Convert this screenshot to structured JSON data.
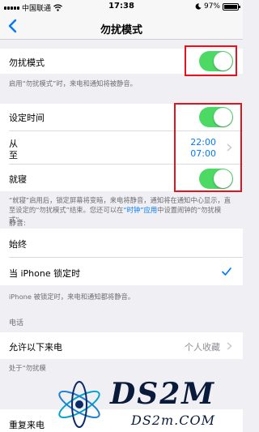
{
  "status": {
    "carrier": "中国联通",
    "time": "17:38",
    "battery": "97%",
    "battery_level": 0.97
  },
  "nav": {
    "title": "勿扰模式",
    "back_icon": "chevron-left-icon"
  },
  "dnd": {
    "label": "勿扰模式",
    "enabled": true
  },
  "dnd_note": "启用“勿扰模式”时，来电和通知将被静音。",
  "scheduled": {
    "label": "设定时间",
    "enabled": true
  },
  "schedule": {
    "from_label": "从",
    "to_label": "至",
    "from_time": "22:00",
    "to_time": "07:00"
  },
  "bedtime": {
    "label": "就寝",
    "enabled": true
  },
  "bedtime_note": {
    "part1": "“就寝”启用后，锁定屏幕将变暗，来电将静音，通知将在通知中心显示，直至设定的“勿扰模式”结束。您还可以在",
    "link": "“时钟”应用",
    "part2": "中设置闹钟的“勿扰模式”。"
  },
  "silence": {
    "header": "静音:",
    "always": "始终",
    "locked": "当 iPhone 锁定时",
    "selected": "locked",
    "note": "iPhone 被锁定时，来电和通知都将静音。"
  },
  "phone": {
    "header": "电话",
    "allow_calls_label": "允许以下来电",
    "allow_calls_value": "个人收藏",
    "note": "处于“勿扰模",
    "repeated_calls": "重复来电"
  },
  "watermark": {
    "brand": "DS2M",
    "url": "DS2m.COM"
  },
  "colors": {
    "accent": "#007aff",
    "toggle_on": "#4cd964",
    "highlight": "#e3141e"
  }
}
